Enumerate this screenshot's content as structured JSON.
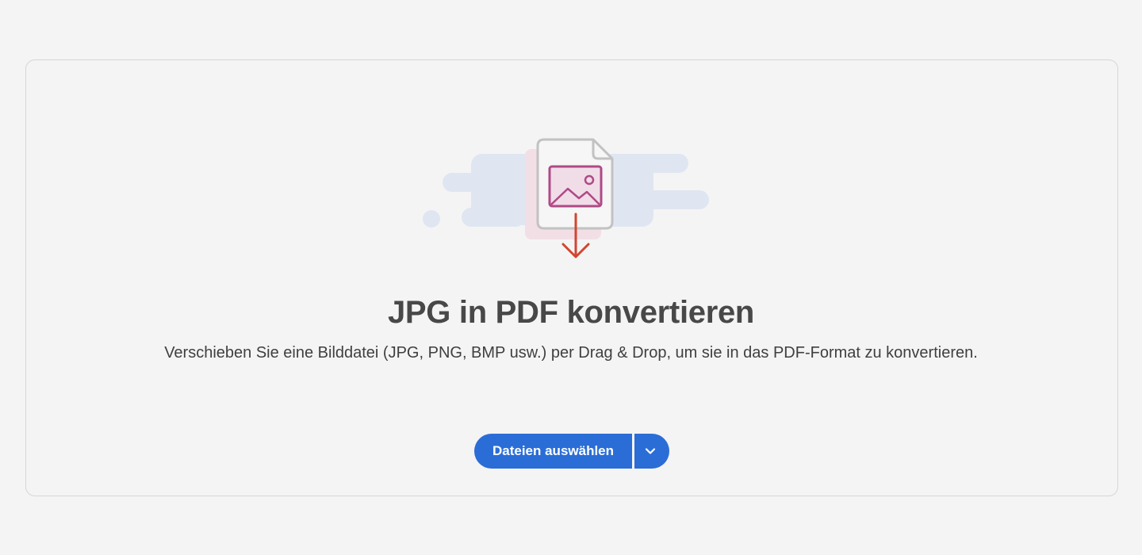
{
  "converter": {
    "title": "JPG in PDF konvertieren",
    "description": "Verschieben Sie eine Bilddatei (JPG, PNG, BMP usw.) per Drag & Drop, um sie in das PDF-Format zu konvertieren.",
    "select_button_label": "Dateien auswählen",
    "dropdown_icon": "chevron-down-icon",
    "illustration_icon": "image-file-download-icon"
  },
  "colors": {
    "page_background": "#f4f4f4",
    "border": "#d6d6d6",
    "primary_button": "#2a6dd6",
    "button_text": "#ffffff",
    "title_text": "#484848",
    "arrow": "#d2452f",
    "image_icon": "#b04a86",
    "cloud_shapes": "#dfe6f1",
    "pink_highlight": "#f2dfe6"
  }
}
